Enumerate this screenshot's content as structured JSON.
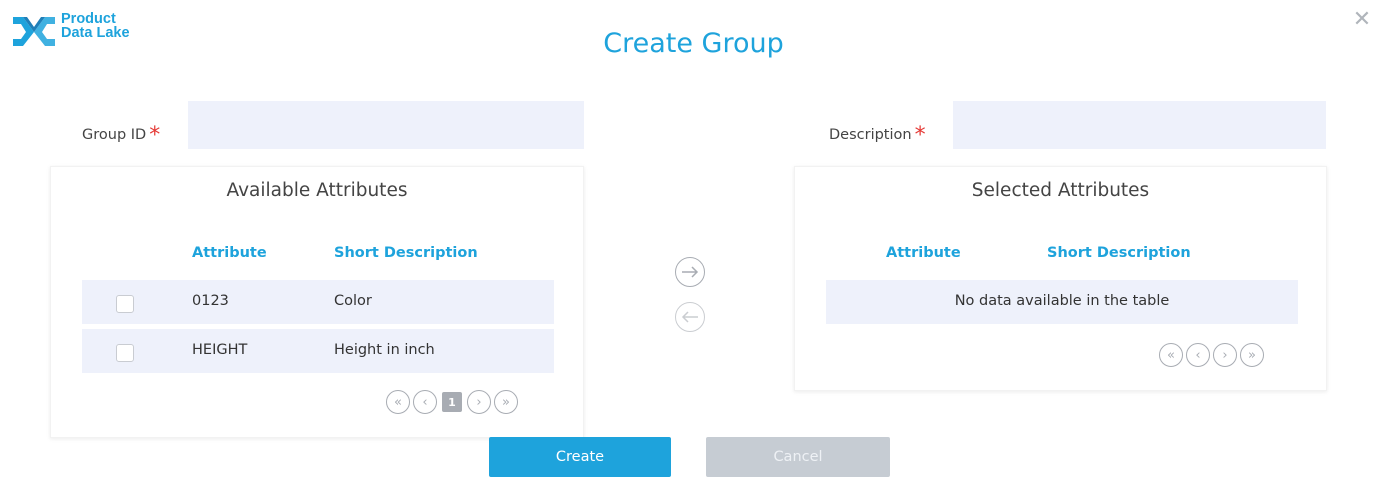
{
  "logo": {
    "line1": "Product",
    "line2": "Data Lake",
    "brand_color": "#1ea3dc"
  },
  "close_icon": "close-icon",
  "title": "Create Group",
  "form": {
    "group_id_label": "Group ID",
    "group_id_value": "",
    "description_label": "Description",
    "description_value": "",
    "required_mark": "*"
  },
  "available": {
    "title": "Available Attributes",
    "columns": [
      "Attribute",
      "Short Description"
    ],
    "rows": [
      {
        "attribute": "0123",
        "short_description": "Color",
        "checked": false
      },
      {
        "attribute": "HEIGHT",
        "short_description": "Height in inch",
        "checked": false
      }
    ],
    "pager": {
      "current_page": "1"
    }
  },
  "selected": {
    "title": "Selected Attributes",
    "columns": [
      "Attribute",
      "Short Description"
    ],
    "empty_message": "No data available in the table"
  },
  "move_buttons": {
    "right": "arrow-right-icon",
    "left": "arrow-left-icon"
  },
  "actions": {
    "create_label": "Create",
    "cancel_label": "Cancel"
  },
  "colors": {
    "accent": "#1ea3dc",
    "row_bg": "#eef1fb",
    "required": "#e53935",
    "cancel_bg": "#c6ccd3"
  }
}
